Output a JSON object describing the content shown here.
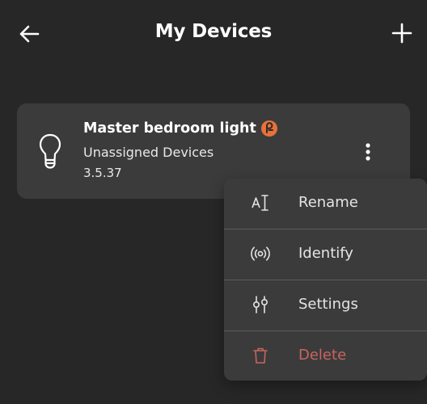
{
  "header": {
    "title": "My Devices",
    "back_icon": "arrow-left-icon",
    "add_icon": "plus-icon"
  },
  "device": {
    "name": "Master bedroom light",
    "group": "Unassigned Devices",
    "version": "3.5.37",
    "icon": "light-bulb-icon",
    "badge_icon": "brand-badge-icon",
    "badge_color": "#e8713a"
  },
  "menu": {
    "items": [
      {
        "label": "Rename",
        "icon": "rename-icon"
      },
      {
        "label": "Identify",
        "icon": "broadcast-icon"
      },
      {
        "label": "Settings",
        "icon": "sliders-icon"
      },
      {
        "label": "Delete",
        "icon": "trash-icon",
        "color": "#c9645f"
      }
    ]
  },
  "colors": {
    "background": "#272727",
    "card": "#3b3b3c",
    "divider": "#5c5c5c",
    "danger": "#c9645f",
    "accent": "#e8713a"
  }
}
